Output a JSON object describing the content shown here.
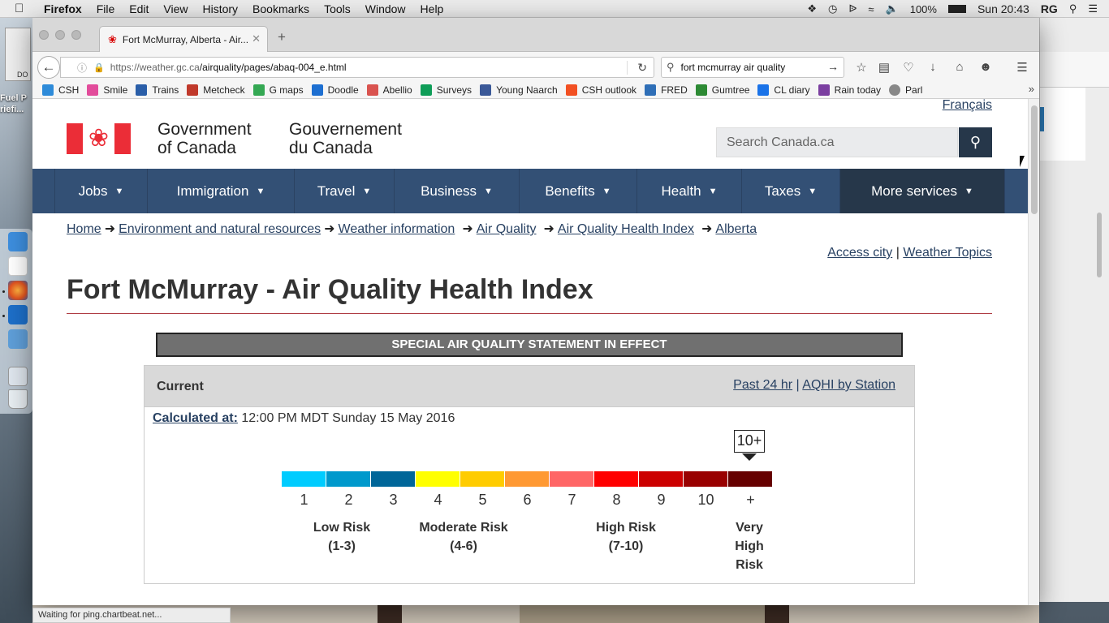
{
  "menubar": {
    "app": "Firefox",
    "menus": [
      "File",
      "Edit",
      "View",
      "History",
      "Bookmarks",
      "Tools",
      "Window",
      "Help"
    ],
    "battery": "100%",
    "clock": "Sun 20:43",
    "user": "RG"
  },
  "desktop": {
    "file_label": "DO",
    "side_label_1": "Fuel P",
    "side_label_2": "riefi..."
  },
  "browser": {
    "tab_title": "Fort McMurray, Alberta - Air...",
    "url_host": "https://weather.gc.ca",
    "url_path": "/airquality/pages/abaq-004_e.html",
    "search_value": "fort mcmurray air quality",
    "status_text": "Waiting for ping.chartbeat.net...",
    "bookmarks": [
      {
        "label": "CSH",
        "color": "#2e8bd9"
      },
      {
        "label": "Smile",
        "color": "#e24c9b"
      },
      {
        "label": "Trains",
        "color": "#2a5ea8"
      },
      {
        "label": "Metcheck",
        "color": "#c0392b"
      },
      {
        "label": "G maps",
        "color": "#34a853"
      },
      {
        "label": "Doodle",
        "color": "#1d6fd1"
      },
      {
        "label": "Abellio",
        "color": "#d9534f"
      },
      {
        "label": "Surveys",
        "color": "#0f9d58"
      },
      {
        "label": "Young Naarch",
        "color": "#3b5998"
      },
      {
        "label": "CSH outlook",
        "color": "#f25022"
      },
      {
        "label": "FRED",
        "color": "#2f6fb7"
      },
      {
        "label": "Gumtree",
        "color": "#2d8a34"
      },
      {
        "label": "CL diary",
        "color": "#1a73e8"
      },
      {
        "label": "Rain today",
        "color": "#7b3fa0"
      },
      {
        "label": "Parl",
        "color": "#888888"
      }
    ]
  },
  "site": {
    "francais": "Français",
    "gov_en_1": "Government",
    "gov_en_2": "of Canada",
    "gov_fr_1": "Gouvernement",
    "gov_fr_2": "du Canada",
    "search_placeholder": "Search Canada.ca",
    "nav": [
      {
        "label": "Jobs"
      },
      {
        "label": "Immigration"
      },
      {
        "label": "Travel"
      },
      {
        "label": "Business"
      },
      {
        "label": "Benefits"
      },
      {
        "label": "Health"
      },
      {
        "label": "Taxes"
      },
      {
        "label": "More services"
      }
    ],
    "breadcrumbs": [
      "Home",
      "Environment and natural resources",
      "Weather information",
      "Air Quality",
      "Air Quality Health Index",
      "Alberta"
    ],
    "access_city": "Access city",
    "weather_topics": "Weather Topics",
    "page_title": "Fort McMurray - Air Quality Health Index",
    "alert": "SPECIAL AIR QUALITY STATEMENT IN EFFECT",
    "partial_text": ""
  },
  "aqhi": {
    "current_label": "Current",
    "past_24": "Past 24 hr",
    "by_station": "AQHI by Station",
    "calculated_label": "Calculated at:",
    "calculated_value": "12:00 PM MDT Sunday 15 May 2016",
    "current_value": "10+",
    "scale": [
      {
        "n": "1",
        "color": "#00ccff"
      },
      {
        "n": "2",
        "color": "#0099cc"
      },
      {
        "n": "3",
        "color": "#006699"
      },
      {
        "n": "4",
        "color": "#ffff00"
      },
      {
        "n": "5",
        "color": "#ffcc00"
      },
      {
        "n": "6",
        "color": "#ff9933"
      },
      {
        "n": "7",
        "color": "#ff6666"
      },
      {
        "n": "8",
        "color": "#ff0000"
      },
      {
        "n": "9",
        "color": "#cc0000"
      },
      {
        "n": "10",
        "color": "#990000"
      },
      {
        "n": "+",
        "color": "#660000"
      }
    ],
    "risk_low": "Low Risk\n(1-3)",
    "risk_moderate": "Moderate Risk\n(4-6)",
    "risk_high": "High Risk\n(7-10)",
    "risk_very_high": "Very\nHigh\nRisk"
  }
}
